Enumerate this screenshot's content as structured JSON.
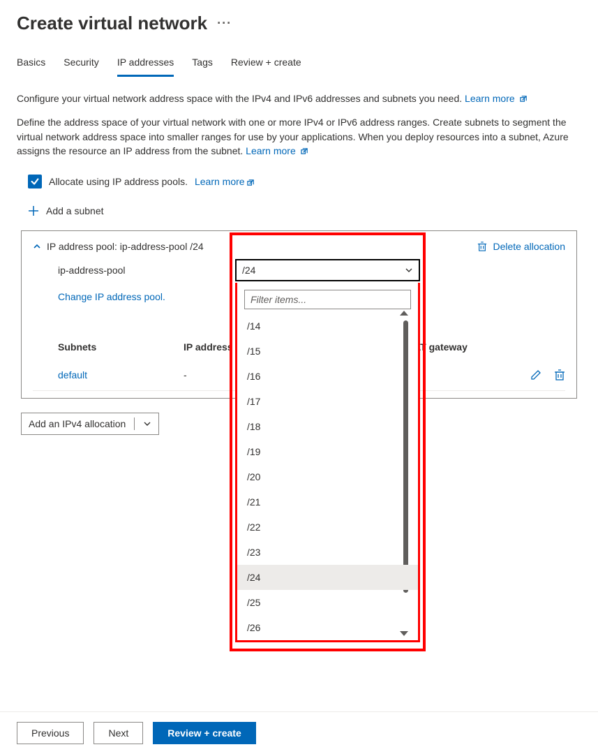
{
  "page_title": "Create virtual network",
  "tabs": [
    "Basics",
    "Security",
    "IP addresses",
    "Tags",
    "Review + create"
  ],
  "active_tab": "IP addresses",
  "intro_text": "Configure your virtual network address space with the IPv4 and IPv6 addresses and subnets you need.",
  "learn_more": "Learn more",
  "desc_text": "Define the address space of your virtual network with one or more IPv4 or IPv6 address ranges. Create subnets to segment the virtual network address space into smaller ranges for use by your applications. When you deploy resources into a subnet, Azure assigns the resource an IP address from the subnet.",
  "checkbox_label": "Allocate using IP address pools.",
  "add_subnet_label": "Add a subnet",
  "pool": {
    "header": "IP address pool: ip-address-pool /24",
    "name": "ip-address-pool",
    "change_link": "Change IP address pool.",
    "delete_label": "Delete allocation",
    "prefix_selected": "/24"
  },
  "prefix_filter_placeholder": "Filter items...",
  "prefix_options": [
    "/14",
    "/15",
    "/16",
    "/17",
    "/18",
    "/19",
    "/20",
    "/21",
    "/22",
    "/23",
    "/24",
    "/25",
    "/26"
  ],
  "table": {
    "headers": {
      "subnets": "Subnets",
      "iprange": "IP address range",
      "nat": "NAT gateway"
    },
    "rows": [
      {
        "name": "default",
        "iprange": "-"
      }
    ]
  },
  "add_allocation_label": "Add an IPv4 allocation",
  "footer": {
    "previous": "Previous",
    "next": "Next",
    "review": "Review + create"
  }
}
